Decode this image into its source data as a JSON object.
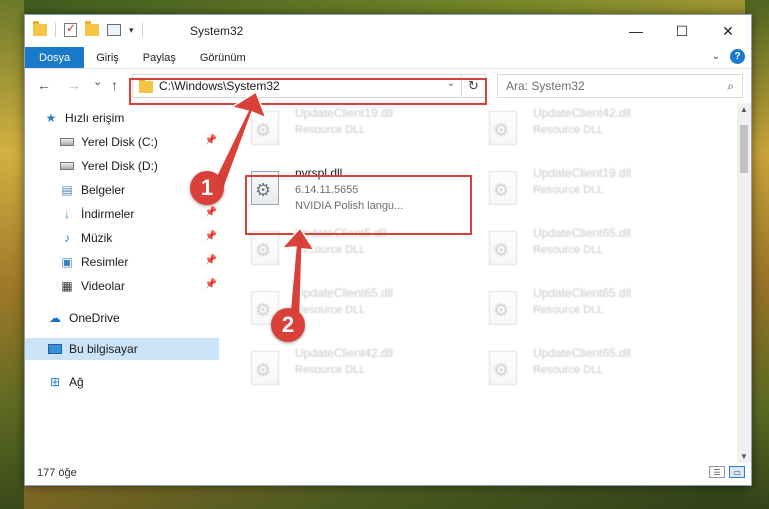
{
  "window": {
    "title": "System32",
    "controls": {
      "minimize": "—",
      "maximize": "☐",
      "close": "✕"
    }
  },
  "ribbon": {
    "tabs": [
      "Dosya",
      "Giriş",
      "Paylaş",
      "Görünüm"
    ],
    "help": "?"
  },
  "nav": {
    "back": "←",
    "forward": "→",
    "recent": "⌄",
    "up": "↑",
    "address": "C:\\Windows\\System32",
    "refresh": "↻",
    "search_placeholder": "Ara: System32",
    "search_icon": "⌕"
  },
  "sidebar": {
    "items": [
      {
        "label": "Hızlı erişim",
        "icon": "star-icon"
      },
      {
        "label": "Yerel Disk (C:)",
        "icon": "disk-icon",
        "pinned": true
      },
      {
        "label": "Yerel Disk (D:)",
        "icon": "disk-icon",
        "pinned": false
      },
      {
        "label": "Belgeler",
        "icon": "documents-icon",
        "pinned": true
      },
      {
        "label": "İndirmeler",
        "icon": "downloads-icon",
        "pinned": true
      },
      {
        "label": "Müzik",
        "icon": "music-icon",
        "pinned": true
      },
      {
        "label": "Resimler",
        "icon": "pictures-icon",
        "pinned": true
      },
      {
        "label": "Videolar",
        "icon": "videos-icon",
        "pinned": true
      },
      {
        "label": "OneDrive",
        "icon": "cloud-icon"
      },
      {
        "label": "Bu bilgisayar",
        "icon": "computer-icon",
        "selected": true
      },
      {
        "label": "Ağ",
        "icon": "network-icon"
      }
    ]
  },
  "files": [
    {
      "name": "UpdateClient19.dll",
      "type": "Resource DLL"
    },
    {
      "name": "UpdateClient42.dll",
      "type": "Resource DLL"
    },
    {
      "name": "nvrspl.dll",
      "version": "6.14.11.5655",
      "desc": "NVIDIA Polish langu..."
    },
    {
      "name": "UpdateClient19.dll",
      "type": "Resource DLL"
    },
    {
      "name": "UpdateClient5.dll",
      "type": "Resource DLL"
    },
    {
      "name": "UpdateClient65.dll",
      "type": "Resource DLL"
    },
    {
      "name": "UpdateClient65.dll",
      "type": "Resource DLL"
    },
    {
      "name": "UpdateClient65.dll",
      "type": "Resource DLL"
    },
    {
      "name": "UpdateClient42.dll",
      "type": "Resource DLL"
    },
    {
      "name": "UpdateClient65.dll",
      "type": "Resource DLL"
    }
  ],
  "status": {
    "count": "177 öğe"
  },
  "annotations": {
    "badge1": "1",
    "badge2": "2",
    "color": "#d9403a"
  }
}
